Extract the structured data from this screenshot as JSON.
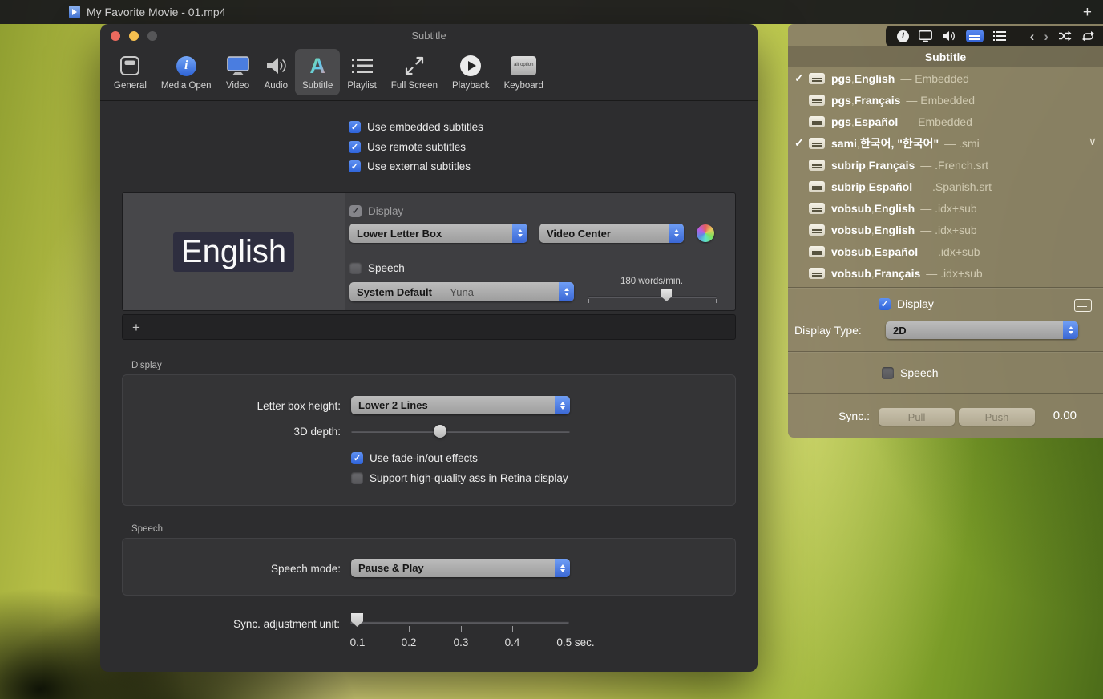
{
  "desktop": {
    "titlebar": {
      "title": "My Favorite Movie - 01.mp4",
      "add_button": "+"
    }
  },
  "prefs": {
    "window_title": "Subtitle",
    "toolbar": [
      {
        "label": "General"
      },
      {
        "label": "Media Open"
      },
      {
        "label": "Video"
      },
      {
        "label": "Audio"
      },
      {
        "label": "Subtitle",
        "selected": true
      },
      {
        "label": "Playlist"
      },
      {
        "label": "Full Screen"
      },
      {
        "label": "Playback"
      },
      {
        "label": "Keyboard"
      }
    ],
    "source_checkboxes": [
      {
        "label": "Use embedded subtitles",
        "checked": true
      },
      {
        "label": "Use remote subtitles",
        "checked": true
      },
      {
        "label": "Use external subtitles",
        "checked": true
      }
    ],
    "preview": {
      "sample_text": "English",
      "display_checkbox": "Display",
      "display_checked": true,
      "position_popup": "Lower Letter Box",
      "anchor_popup": "Video Center",
      "speech_checkbox": "Speech",
      "speech_checked": false,
      "voice_popup_name": "System Default",
      "voice_popup_detail": "— Yuna",
      "rate_label": "180 words/min."
    },
    "add_row": "+",
    "display_section": {
      "title": "Display",
      "letterbox_label": "Letter box height:",
      "letterbox_value": "Lower 2 Lines",
      "depth_label": "3D depth:",
      "fade_checkbox": "Use fade-in/out effects",
      "fade_checked": true,
      "retina_checkbox": "Support high-quality ass in Retina display",
      "retina_checked": false
    },
    "speech_section": {
      "title": "Speech",
      "mode_label": "Speech mode:",
      "mode_value": "Pause & Play"
    },
    "sync_slider": {
      "label": "Sync. adjustment unit:",
      "value": "0.1",
      "tick_labels": [
        "0.1",
        "0.2",
        "0.3",
        "0.4",
        "0.5 sec."
      ]
    }
  },
  "hud": {
    "panel_title": "Subtitle",
    "separator": " , ",
    "tracks": [
      {
        "checked": true,
        "format": "pgs",
        "language": "English",
        "extra": "",
        "detail": "— Embedded"
      },
      {
        "checked": false,
        "format": "pgs",
        "language": "Français",
        "extra": "",
        "detail": "— Embedded"
      },
      {
        "checked": false,
        "format": "pgs",
        "language": "Español",
        "extra": "",
        "detail": "— Embedded"
      },
      {
        "checked": true,
        "format": "sami",
        "language": "한국어",
        "extra": " , \"한국어\"",
        "detail": "— .smi"
      },
      {
        "checked": false,
        "format": "subrip",
        "language": "Français",
        "extra": "",
        "detail": "— .French.srt"
      },
      {
        "checked": false,
        "format": "subrip",
        "language": "Español",
        "extra": "",
        "detail": "— .Spanish.srt"
      },
      {
        "checked": false,
        "format": "vobsub",
        "language": "English",
        "extra": "",
        "detail": "— .idx+sub"
      },
      {
        "checked": false,
        "format": "vobsub",
        "language": "English",
        "extra": "",
        "detail": "— .idx+sub"
      },
      {
        "checked": false,
        "format": "vobsub",
        "language": "Español",
        "extra": "",
        "detail": "— .idx+sub"
      },
      {
        "checked": false,
        "format": "vobsub",
        "language": "Français",
        "extra": "",
        "detail": "— .idx+sub"
      }
    ],
    "display_checkbox": "Display",
    "display_checked": true,
    "display_type_label": "Display Type:",
    "display_type_value": "2D",
    "speech_checkbox": "Speech",
    "speech_checked": false,
    "sync_label": "Sync.:",
    "sync_buttons": [
      {
        "label": "Pull"
      },
      {
        "label": "Push"
      }
    ],
    "sync_value": "0.00"
  },
  "icons": {
    "prev": "‹",
    "next": "›",
    "expander": "∨",
    "keyboard_key": "alt option"
  },
  "colors": {
    "accent_blue": "#3a67d5",
    "checkbox_blue": "#2e63da",
    "hud_tan": "#8b8167"
  }
}
